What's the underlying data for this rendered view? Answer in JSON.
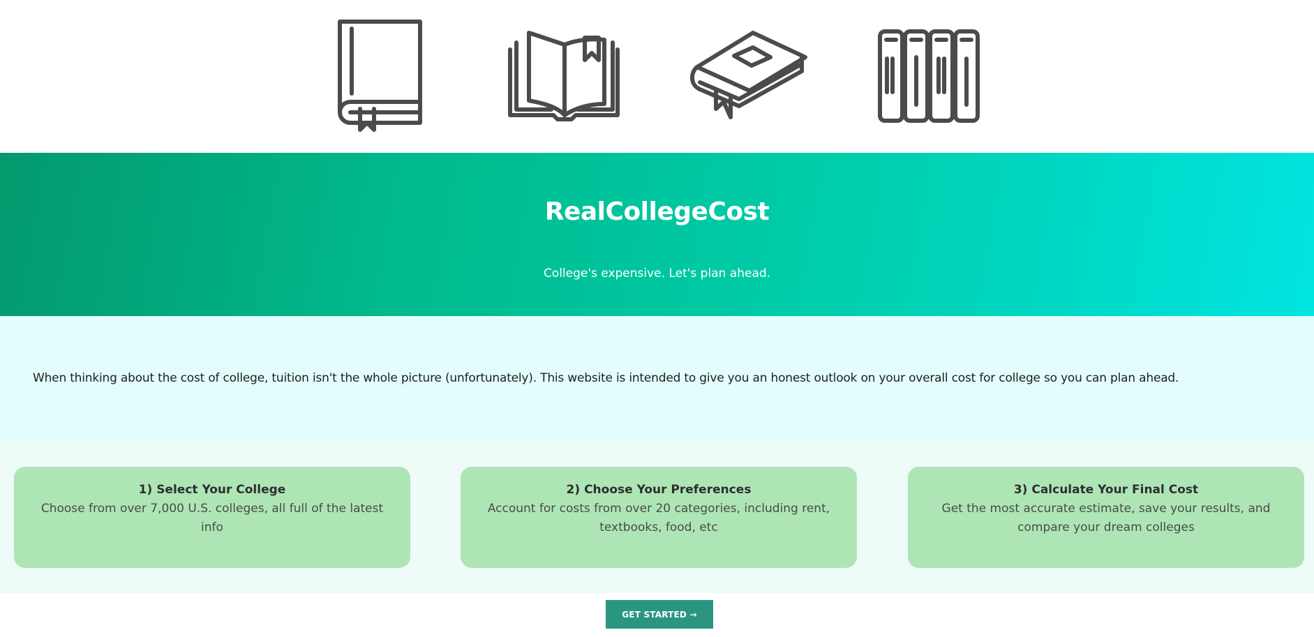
{
  "hero": {
    "title": "RealCollegeCost",
    "subtitle": "College's expensive. Let's plan ahead."
  },
  "intro": {
    "text": "When thinking about the cost of college, tuition isn't the whole picture (unfortunately). This website is intended to give you an honest outlook on your overall cost for college so you can plan ahead."
  },
  "steps": [
    {
      "title": "1) Select Your College",
      "description": "Choose from over 7,000 U.S. colleges, all full of the latest info"
    },
    {
      "title": "2) Choose Your Preferences",
      "description": "Account for costs from over 20 categories, including rent, textbooks, food, etc"
    },
    {
      "title": "3) Calculate Your Final Cost",
      "description": "Get the most accurate estimate, save your results, and compare your dream colleges"
    }
  ],
  "cta": {
    "label": "GET STARTED →"
  },
  "icons": [
    "closed-book-icon",
    "open-book-bookmark-icon",
    "lying-book-icon",
    "bookshelf-icon"
  ],
  "colors": {
    "hero_gradient_start": "#03996d",
    "hero_gradient_end": "#00e4e0",
    "intro_background": "#e3fdfd",
    "card_background": "#ade6b4",
    "button_background": "#2a9682",
    "icon_stroke": "#4b4b4b"
  }
}
